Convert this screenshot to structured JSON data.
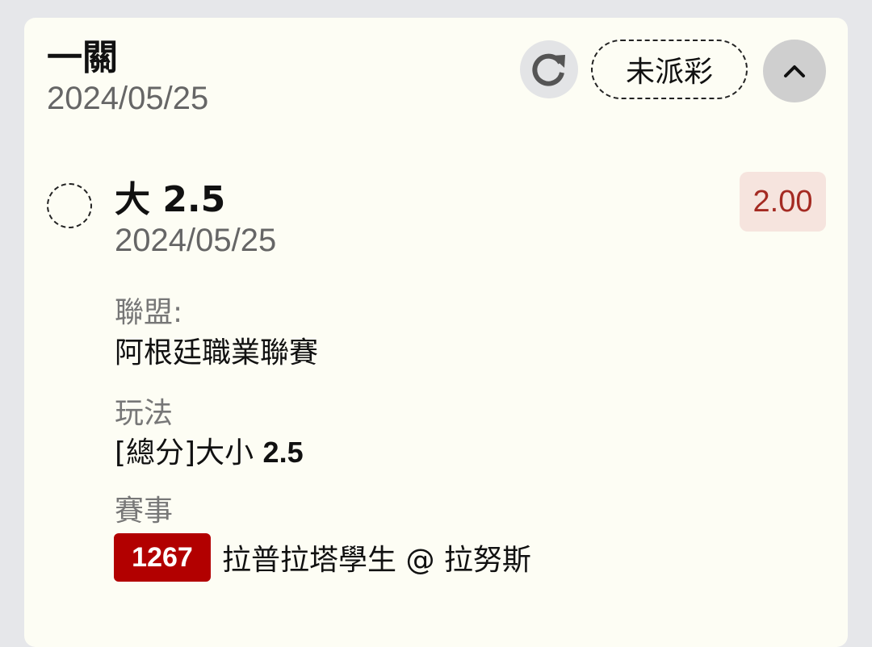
{
  "header": {
    "title": "一關",
    "date": "2024/05/25",
    "status_label": "未派彩"
  },
  "selection": {
    "title": "大 2.5",
    "date": "2024/05/25",
    "odds": "2.00",
    "league_label": "聯盟:",
    "league_value": "阿根廷職業聯賽",
    "market_label": "玩法",
    "market_prefix": "[總分]大小 ",
    "market_line": "2.5",
    "event_label": "賽事",
    "event_code": "1267",
    "event_teams": "拉普拉塔學生 @ 拉努斯"
  },
  "icons": {
    "refresh": "refresh-icon",
    "collapse": "chevron-up-icon",
    "radio": "radio-unselected-icon"
  },
  "colors": {
    "card_bg": "#fdfdf4",
    "odds_text": "#a42a22",
    "odds_bg": "#f6e4de",
    "event_code_bg": "#b20000"
  }
}
